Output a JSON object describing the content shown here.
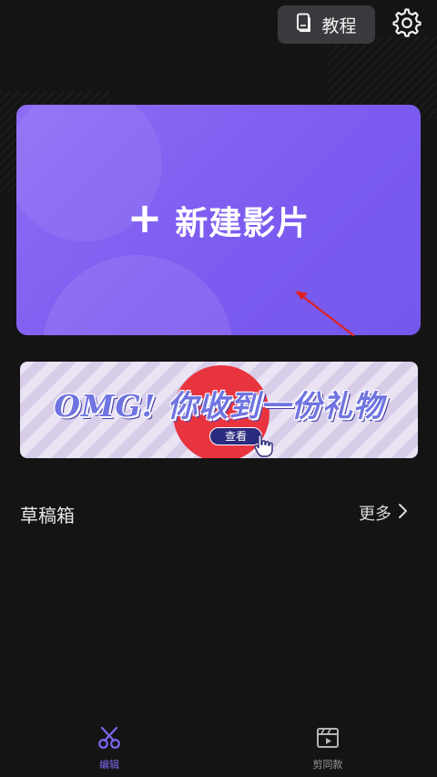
{
  "header": {
    "tutorial_label": "教程",
    "tutorial_icon": "book-icon",
    "settings_icon": "gear-icon"
  },
  "new_movie": {
    "plus": "+",
    "label": "新建影片",
    "accent": "#7d5cf0"
  },
  "gift_banner": {
    "headline": "OMG! 你收到一份礼物",
    "button_label": "查看",
    "icon": "hand-pointer-icon"
  },
  "drafts": {
    "title": "草稿箱",
    "more_label": "更多"
  },
  "bottom_nav": {
    "items": [
      {
        "label": "编辑",
        "icon": "scissors-icon",
        "active": true
      },
      {
        "label": "剪同款",
        "icon": "clapperboard-icon",
        "active": false
      }
    ]
  },
  "colors": {
    "background": "#141414",
    "accent": "#8066f2",
    "annotation_arrow": "#e02020"
  }
}
